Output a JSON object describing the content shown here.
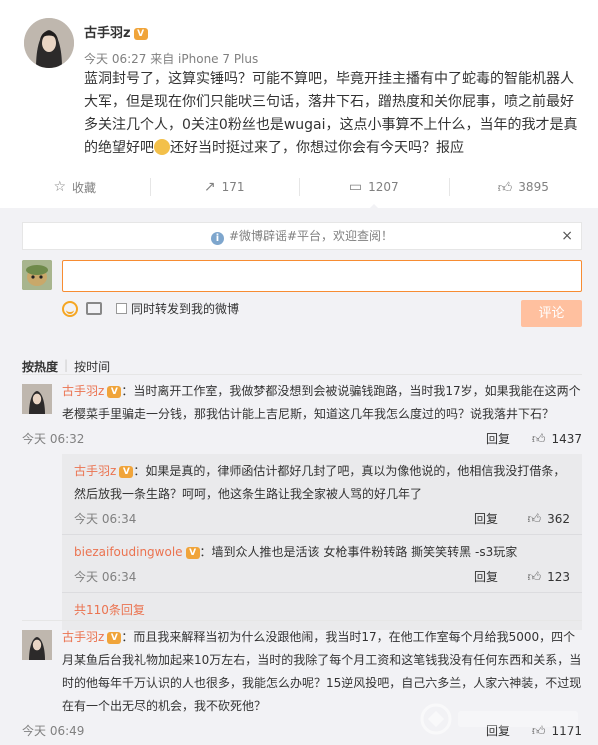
{
  "post": {
    "author": "古手羽z",
    "badge": "V",
    "time": "今天 06:27",
    "source": "来自 iPhone 7 Plus",
    "text_part1": "蓝洞封号了，这算实锤吗？可能不算吧，毕竟开挂主播有中了蛇毒的智能机器人大军，但是现在你们只能吠三句话，落井下石，蹭热度和关你屁事，喷之前最好多关注几个人，0关注0粉丝也是wugai，这点小事算不上什么，当年的我才是真的绝望好吧",
    "text_part2": "还好当时挺过来了，你想过你会有今天吗？报应"
  },
  "actions": [
    {
      "icon": "star-icon",
      "label": "收藏"
    },
    {
      "icon": "share-icon",
      "label": "171"
    },
    {
      "icon": "comment-icon",
      "label": "1207"
    },
    {
      "icon": "like-icon",
      "label": "3895"
    }
  ],
  "notice": {
    "text": "#微博辟谣#平台，欢迎查阅！",
    "close": "×"
  },
  "composer": {
    "input_value": "",
    "repost_label": "同时转发到我的微博",
    "submit_label": "评论"
  },
  "sort": {
    "hot": "按热度",
    "time": "按时间"
  },
  "comments": [
    {
      "user": "古手羽z",
      "text": "：当时离开工作室，我做梦都没想到会被说骗钱跑路，当时我17岁，如果我能在这两个老樱菜手里骗走一分钱，那我估计能上吉尼斯，知道这几年我怎么度过的吗？说我落井下石？",
      "time": "今天 06:32",
      "reply": "回复",
      "likes": "1437",
      "subs": [
        {
          "user": "古手羽z",
          "text": "：如果是真的，律师函估计都好几封了吧，真以为像他说的，他相信我没打借条，然后放我一条生路？呵呵，他这条生路让我全家被人骂的好几年了",
          "time": "今天 06:34",
          "reply": "回复",
          "likes": "362"
        },
        {
          "user": "biezaifoudingwole",
          "text": "：墙到众人推也是活该 女枪事件粉转路  撕笑笑转黑 -s3玩家",
          "time": "今天 06:34",
          "reply": "回复",
          "likes": "123"
        }
      ],
      "more": "共110条回复"
    },
    {
      "user": "古手羽z",
      "text": "：而且我来解释当初为什么没跟他闹，我当时17，在他工作室每个月给我5000，四个月某鱼后台我礼物加起来10万左右，当时的我除了每个月工资和这笔钱我没有任何东西和关系，当时的他每年千万认识的人也很多，我能怎么办呢？15逆风投吧，自己六多兰，人家六神装，不过现在有一个出无尽的机会，我不砍死他？",
      "time": "今天 06:49",
      "reply": "回复",
      "likes": "1171"
    }
  ]
}
